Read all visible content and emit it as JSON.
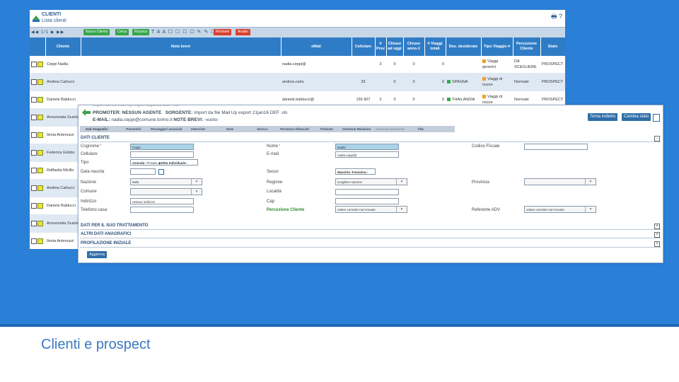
{
  "slide": {
    "caption": "Clienti e prospect"
  },
  "list": {
    "title": "CLIENTI",
    "subtitle": "Lista clienti",
    "header_icons": "🖶 ?",
    "nav": "◀◀ 1/1 ▶ ▶▶",
    "toolbar_icons": "T A A ☐ ☐ ☐ ☐ ✎ ✎ ☐",
    "buttons": [
      "Nuovo Cliente",
      "Cerca",
      "Ricarica",
      "Richiami",
      "Analisi"
    ],
    "columns": [
      "",
      "Cliente",
      "Note brevi",
      "eMail",
      "Cellulare",
      "# Prev",
      "Chiuse ad oggi",
      "Chiuse anno-1",
      "# Viaggi totali",
      "Des. desiderate",
      "Tipo Viaggio ▾",
      "Percezione Cliente",
      "Stato"
    ],
    "rows": [
      {
        "cliente": "Ceppi Nadia",
        "note": "",
        "email": "nadia.ceppi@",
        "cellulare": "",
        "prev": "3",
        "chiuse_oggi": "0",
        "chiuse_anno": "0",
        "viaggi": "0",
        "des": "",
        "tipo": "Viaggi generici",
        "percezione": "DA SCEGLIERE",
        "stato": "PROSPECT"
      },
      {
        "cliente": "Andrea Carlucci",
        "note": "",
        "email": "andrea.carlu",
        "cellulare": "33",
        "prev": "",
        "chiuse_oggi": "0",
        "chiuse_anno": "0",
        "viaggi": "0",
        "des": "SPAGNA",
        "tipo": "Viaggi di nozze",
        "percezione": "Normale",
        "stato": "PROSPECT"
      },
      {
        "cliente": "Daniele Balducci",
        "note": "",
        "email": "daniele.balducci@",
        "cellulare": "155 907",
        "prev": "2",
        "chiuse_oggi": "0",
        "chiuse_anno": "0",
        "viaggi": "0",
        "des": "THAILANDIA",
        "tipo": "Viaggi di nozze",
        "percezione": "Normale",
        "stato": "PROSPECT"
      },
      {
        "cliente": "Annunziata Scarlata",
        "note": "",
        "email": "",
        "cellulare": "",
        "prev": "",
        "chiuse_oggi": "",
        "chiuse_anno": "",
        "viaggi": "",
        "des": "",
        "tipo": "",
        "percezione": "",
        "stato": ""
      },
      {
        "cliente": "Ilenia Antenozzi",
        "note": "",
        "email": "",
        "cellulare": "",
        "prev": "",
        "chiuse_oggi": "",
        "chiuse_anno": "",
        "viaggi": "",
        "des": "",
        "tipo": "",
        "percezione": "",
        "stato": ""
      },
      {
        "cliente": "Federica Gobbo",
        "note": "",
        "email": "",
        "cellulare": "",
        "prev": "",
        "chiuse_oggi": "",
        "chiuse_anno": "",
        "viaggi": "",
        "des": "",
        "tipo": "",
        "percezione": "",
        "stato": ""
      },
      {
        "cliente": "Raffaella Micillo",
        "note": "",
        "email": "",
        "cellulare": "",
        "prev": "",
        "chiuse_oggi": "",
        "chiuse_anno": "",
        "viaggi": "",
        "des": "",
        "tipo": "",
        "percezione": "",
        "stato": ""
      },
      {
        "cliente": "Andrea Carlucci",
        "note": "",
        "email": "",
        "cellulare": "",
        "prev": "",
        "chiuse_oggi": "",
        "chiuse_anno": "",
        "viaggi": "",
        "des": "",
        "tipo": "",
        "percezione": "",
        "stato": ""
      },
      {
        "cliente": "Daniele Balducci",
        "note": "",
        "email": "",
        "cellulare": "",
        "prev": "",
        "chiuse_oggi": "",
        "chiuse_anno": "",
        "viaggi": "",
        "des": "",
        "tipo": "",
        "percezione": "",
        "stato": ""
      },
      {
        "cliente": "Annunziata Scarlata",
        "note": "",
        "email": "",
        "cellulare": "",
        "prev": "",
        "chiuse_oggi": "",
        "chiuse_anno": "",
        "viaggi": "",
        "des": "",
        "tipo": "",
        "percezione": "",
        "stato": ""
      },
      {
        "cliente": "Ilenia Antenozzi",
        "note": "",
        "email": "",
        "cellulare": "",
        "prev": "",
        "chiuse_oggi": "",
        "chiuse_anno": "",
        "viaggi": "",
        "des": "",
        "tipo": "",
        "percezione": "",
        "stato": ""
      }
    ]
  },
  "detail": {
    "promoter_label": "PROMOTER:",
    "promoter_value": "NESSUN AGENTE",
    "sorgente_label": "SORGENTE:",
    "sorgente_value": "import da file Mail Up export 21jan16 DEF .xls",
    "email_label": "E-MAIL:",
    "email_value": "nadia.ceppi@comune.torino.it",
    "note_label": "NOTE BREVI:",
    "note_value": "-vuoto-",
    "btn_back": "Torna indietro",
    "btn_state": "Cambia stato",
    "tabs": [
      "Dati Anagrafici",
      "Preventivi",
      "Passeggeri associati",
      "Interviste",
      "Note",
      "Storico",
      "Permessi Rilasciati",
      "Pratiche",
      "Gestione Relazioni",
      "Gestione prenotate",
      "File"
    ],
    "section_main": "DATI CLIENTE",
    "labels": {
      "cognome": "Cognome",
      "nome": "Nome",
      "codice_fiscale": "Codice Fiscale",
      "cellulare": "Cellulare",
      "email": "E-mail",
      "tipo": "Tipo",
      "data_nascita": "Data nascita",
      "sesso": "Sesso",
      "nazione": "Nazione",
      "regione": "Regione",
      "provincia": "Provincia",
      "comune": "Comune",
      "localita": "Località",
      "indirizzo": "Indirizzo",
      "cap": "Cap",
      "telefono_casa": "Telefono casa",
      "percezione": "Percezione Cliente",
      "referente": "Referente ADV"
    },
    "values": {
      "cognome": "Ceppi",
      "nome": "Nadia",
      "email": "nadia.ceppi@",
      "nazione": "Italia",
      "regione": "scegliere nazione",
      "indirizzo": "nessun indirizzo",
      "percezione": "valore corrente non trovato",
      "referente": "valore corrente non trovato"
    },
    "tipo_options": [
      "Azienda",
      "Privato",
      "Ditta Individuale"
    ],
    "sesso_options": [
      "Maschio",
      "Femmina"
    ],
    "sections": [
      "DATI PER IL SUO TRATTAMENTO",
      "ALTRI DATI ANAGRAFICI",
      "PROFILAZIONE INIZIALE"
    ],
    "btn_update": "Aggiorna"
  },
  "colors": {
    "slide_blue": "#2a7fd6",
    "header_blue": "#2f7cc6",
    "prospect_orange": "#f0a020",
    "green_button": "#36a64a",
    "red_button": "#d8402e"
  }
}
